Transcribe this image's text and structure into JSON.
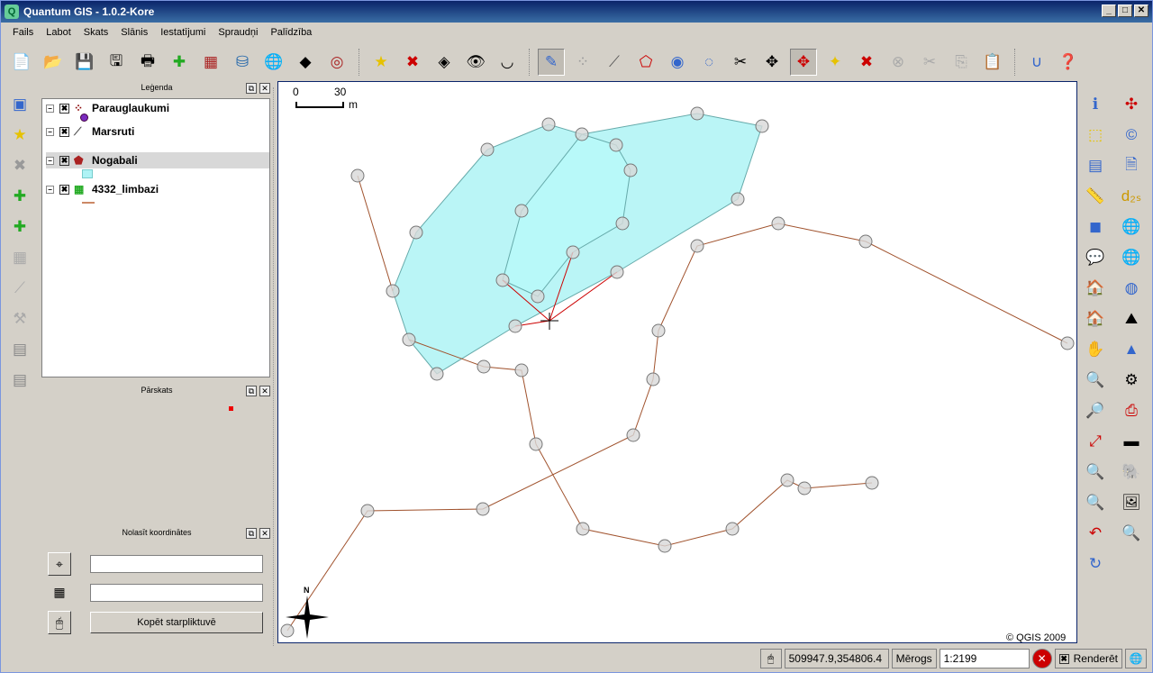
{
  "window": {
    "title": "Quantum GIS - 1.0.2-Kore",
    "minimize": "_",
    "maximize": "□",
    "close": "✕"
  },
  "menu": [
    "Fails",
    "Labot",
    "Skats",
    "Slānis",
    "Iestatījumi",
    "Spraudņi",
    "Palīdzība"
  ],
  "legend": {
    "title": "Leģenda",
    "layers": [
      {
        "name": "Parauglaukumi",
        "check": "✖",
        "expander": "−"
      },
      {
        "name": "Marsruti",
        "check": "✖",
        "expander": "−"
      },
      {
        "name": "Nogabali",
        "check": "✖",
        "expander": "−"
      },
      {
        "name": "4332_limbazi",
        "check": "✖",
        "expander": "−"
      }
    ]
  },
  "overview": {
    "title": "Pārskats"
  },
  "coords_panel": {
    "title": "Nolasīt koordinātes",
    "copy_button": "Kopēt starpliktuvē",
    "input1": "",
    "input2": ""
  },
  "map": {
    "scalebar_start": "0",
    "scalebar_end": "30",
    "scalebar_unit": "m",
    "north_label": "N",
    "copyright": "© QGIS 2009",
    "polygon_fill": "#aef3f5",
    "line_color": "#a0522d",
    "edit_line_color": "#cc0000"
  },
  "status": {
    "coordinates": "509947.9,354806.4",
    "scale_label": "Mērogs",
    "scale_value": "1:2199",
    "render_label": "Renderēt",
    "render_check": "✖"
  },
  "panel_btns": {
    "float": "⧉",
    "close": "✕"
  }
}
